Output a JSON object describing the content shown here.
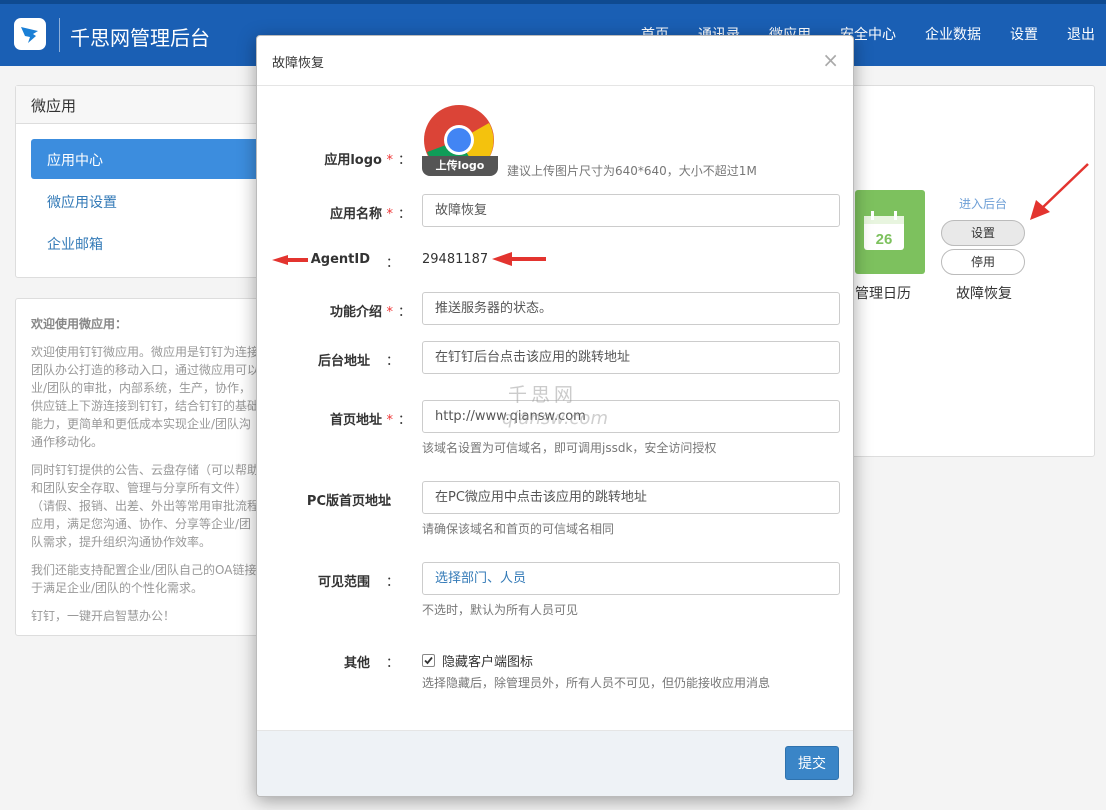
{
  "header": {
    "title": "千思网管理后台",
    "nav": [
      "首页",
      "通讯录",
      "微应用",
      "安全中心",
      "企业数据",
      "设置",
      "退出"
    ]
  },
  "sidebar": {
    "title": "微应用",
    "items": [
      {
        "label": "应用中心",
        "active": true
      },
      {
        "label": "微应用设置",
        "active": false
      },
      {
        "label": "企业邮箱",
        "active": false
      }
    ]
  },
  "welcome": {
    "title": "欢迎使用微应用：",
    "paragraphs": [
      "欢迎使用钉钉微应用。微应用是钉钉为连接团队办公打造的移动入口，通过微应用可以业/团队的审批，内部系统，生产，协作，供应链上下游连接到钉钉，结合钉钉的基础能力，更简单和更低成本实现企业/团队沟通作移动化。",
      "同时钉钉提供的公告、云盘存储（可以帮助和团队安全存取、管理与分享所有文件）（请假、报销、出差、外出等常用审批流程应用，满足您沟通、协作、分享等企业/团队需求，提升组织沟通协作效率。",
      "我们还能支持配置企业/团队自己的OA链接于满足企业/团队的个性化需求。",
      "钉钉，一键开启智慧办公！"
    ]
  },
  "apps": {
    "calendar_day": "26",
    "calendar_label": "管理日历",
    "enter_link": "进入后台",
    "settings_btn": "设置",
    "disable_btn": "停用",
    "app_label": "故障恢复"
  },
  "modal": {
    "title": "故障恢复",
    "close": "×",
    "logo_label": "应用logo",
    "upload_btn": "上传logo",
    "logo_hint": "建议上传图片尺寸为640*640，大小不超过1M",
    "name_label": "应用名称",
    "name_value": "故障恢复",
    "agent_label": "AgentID",
    "agent_value": "29481187",
    "desc_label": "功能介绍",
    "desc_value": "推送服务器的状态。",
    "backend_label": "后台地址",
    "backend_placeholder": "在钉钉后台点击该应用的跳转地址",
    "home_label": "首页地址",
    "home_value": "http://www.qiansw.com",
    "home_hint": "该域名设置为可信域名，即可调用jssdk，安全访问授权",
    "pc_label": "PC版首页地址",
    "pc_placeholder": "在PC微应用中点击该应用的跳转地址",
    "pc_hint": "请确保该域名和首页的可信域名相同",
    "scope_label": "可见范围",
    "scope_value": "选择部门、人员",
    "scope_hint": "不选时，默认为所有人员可见",
    "other_label": "其他",
    "hide_icon_label": "隐藏客户端图标",
    "hide_icon_checked": true,
    "hide_hint": "选择隐藏后，除管理员外，所有人员不可见，但仍能接收应用消息",
    "submit": "提交",
    "required_mark": "*",
    "colon": "："
  },
  "watermark": {
    "line1": "千思网",
    "line2": "qiansw.com"
  },
  "colors": {
    "header_bg": "#1a5fb4",
    "active_item": "#3c8dde",
    "calendar_tile": "#7dc15e",
    "submit_btn": "#3a85c7",
    "arrow": "#e3342f"
  }
}
